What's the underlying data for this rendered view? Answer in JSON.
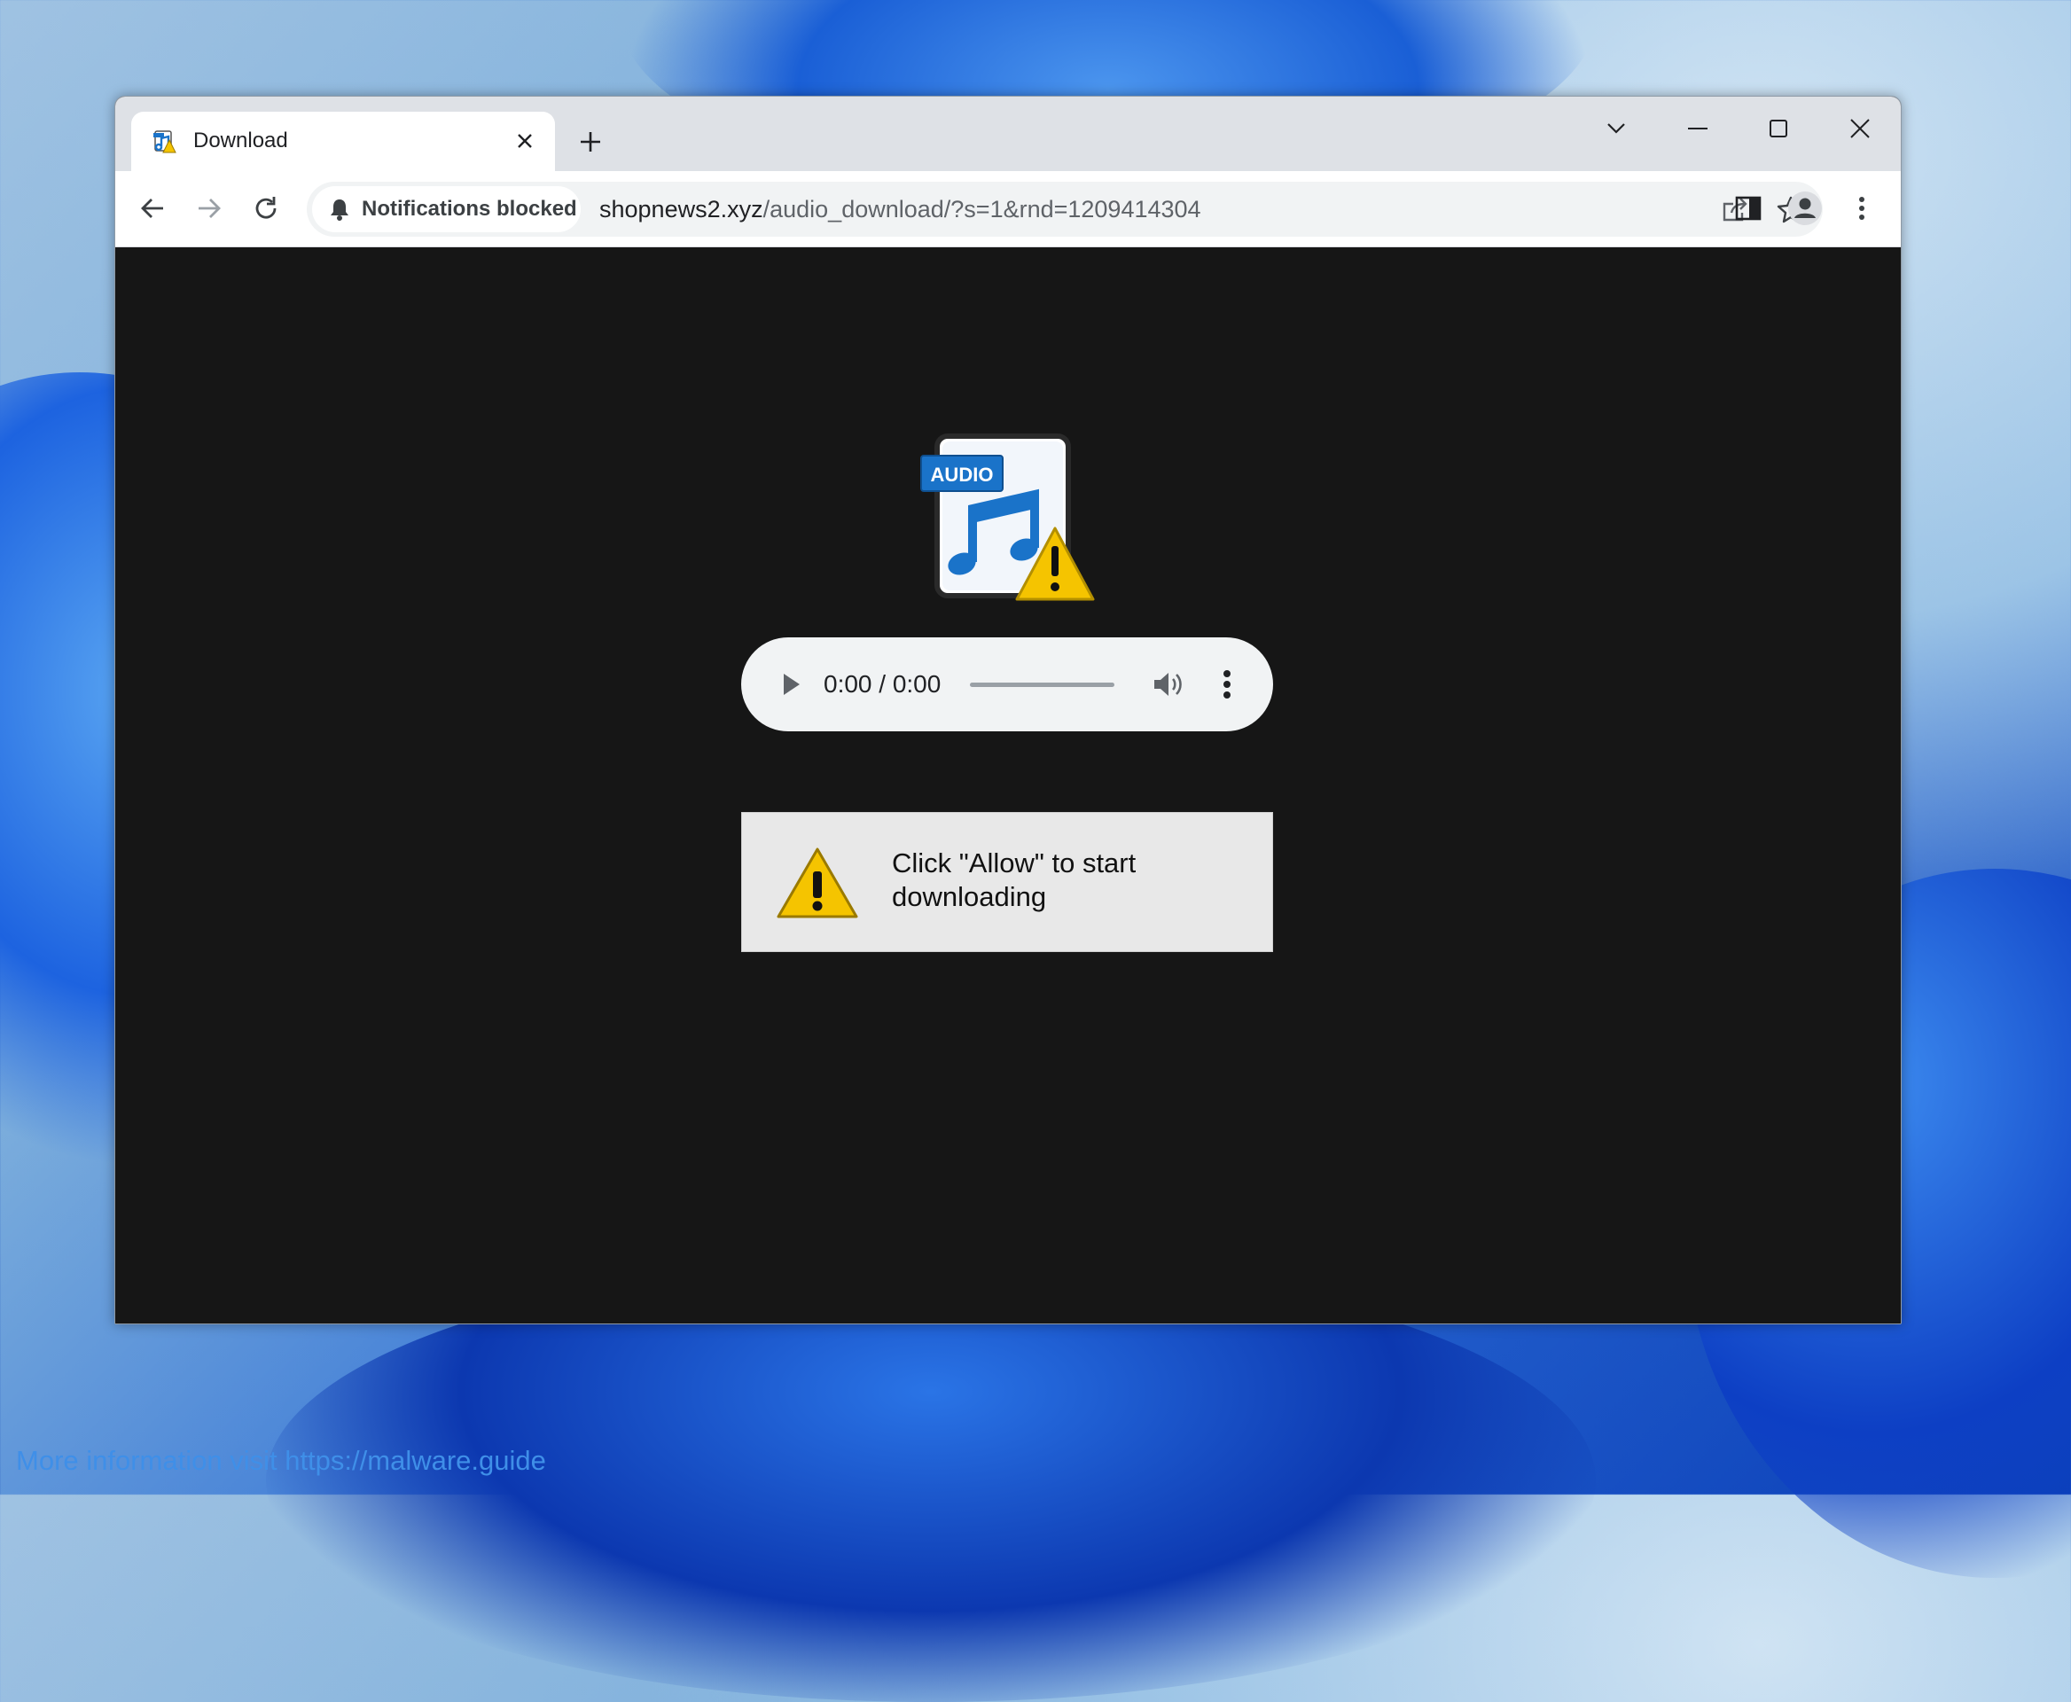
{
  "browser": {
    "tab": {
      "title": "Download",
      "favicon": "audio-file-favicon"
    },
    "controls": {
      "tab_search": "chevron-down-icon",
      "minimize": "minimize-icon",
      "maximize": "maximize-icon",
      "close": "close-icon"
    },
    "toolbar": {
      "back": "back-arrow-icon",
      "forward": "forward-arrow-icon",
      "reload": "reload-icon",
      "notification_chip": "Notifications blocked",
      "url_host": "shopnews2.xyz",
      "url_path": "/audio_download/?s=1&rnd=1209414304"
    }
  },
  "page": {
    "audio_badge": "AUDIO",
    "player": {
      "time": "0:00 / 0:00",
      "progress": 0
    },
    "notice": "Click \"Allow\" to start downloading"
  },
  "watermark": "More information visit https://malware.guide",
  "colors": {
    "page_bg": "#161616",
    "warning_yellow": "#f5c400",
    "audio_blue": "#1a73c9",
    "watermark": "#3f8fe8"
  }
}
